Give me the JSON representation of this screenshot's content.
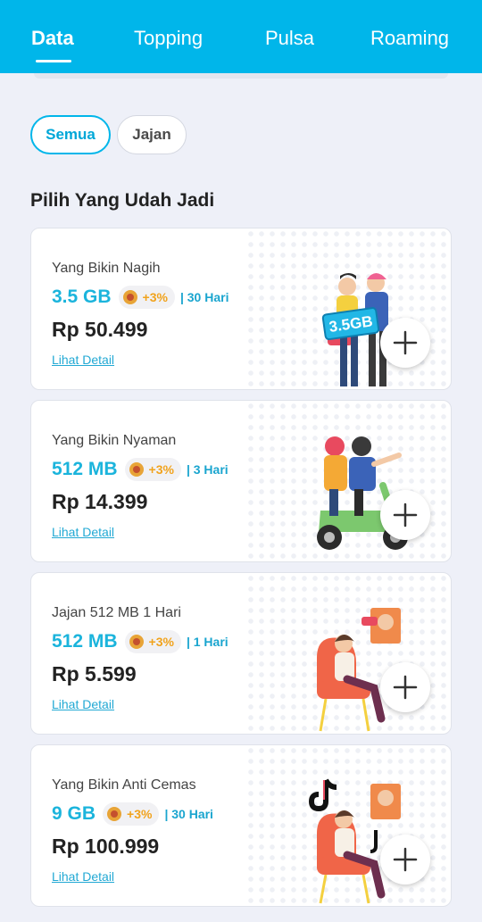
{
  "tabs": [
    {
      "label": "Data"
    },
    {
      "label": "Topping"
    },
    {
      "label": "Pulsa"
    },
    {
      "label": "Roaming"
    }
  ],
  "filters": {
    "all": "Semua",
    "snack": "Jajan"
  },
  "section_title": "Pilih Yang Udah Jadi",
  "products": [
    {
      "name": "Yang Bikin Nagih",
      "quota": "3.5 GB",
      "bonus": "+3%",
      "period": "| 30 Hari",
      "price": "Rp 50.499",
      "detail": "Lihat Detail",
      "badge": "3.5GB"
    },
    {
      "name": "Yang Bikin Nyaman",
      "quota": "512 MB",
      "bonus": "+3%",
      "period": "| 3 Hari",
      "price": "Rp 14.399",
      "detail": "Lihat Detail"
    },
    {
      "name": "Jajan 512 MB 1 Hari",
      "quota": "512 MB",
      "bonus": "+3%",
      "period": "| 1 Hari",
      "price": "Rp 5.599",
      "detail": "Lihat Detail"
    },
    {
      "name": "Yang Bikin Anti Cemas",
      "quota": "9 GB",
      "bonus": "+3%",
      "period": "| 30 Hari",
      "price": "Rp 100.999",
      "detail": "Lihat Detail"
    }
  ],
  "colors": {
    "brand": "#00b6ea",
    "quota": "#1bb4dc",
    "bonus": "#f1a31d",
    "link": "#22a9d4"
  },
  "icons": {
    "add": "plus-icon",
    "bonus": "medal-icon"
  }
}
